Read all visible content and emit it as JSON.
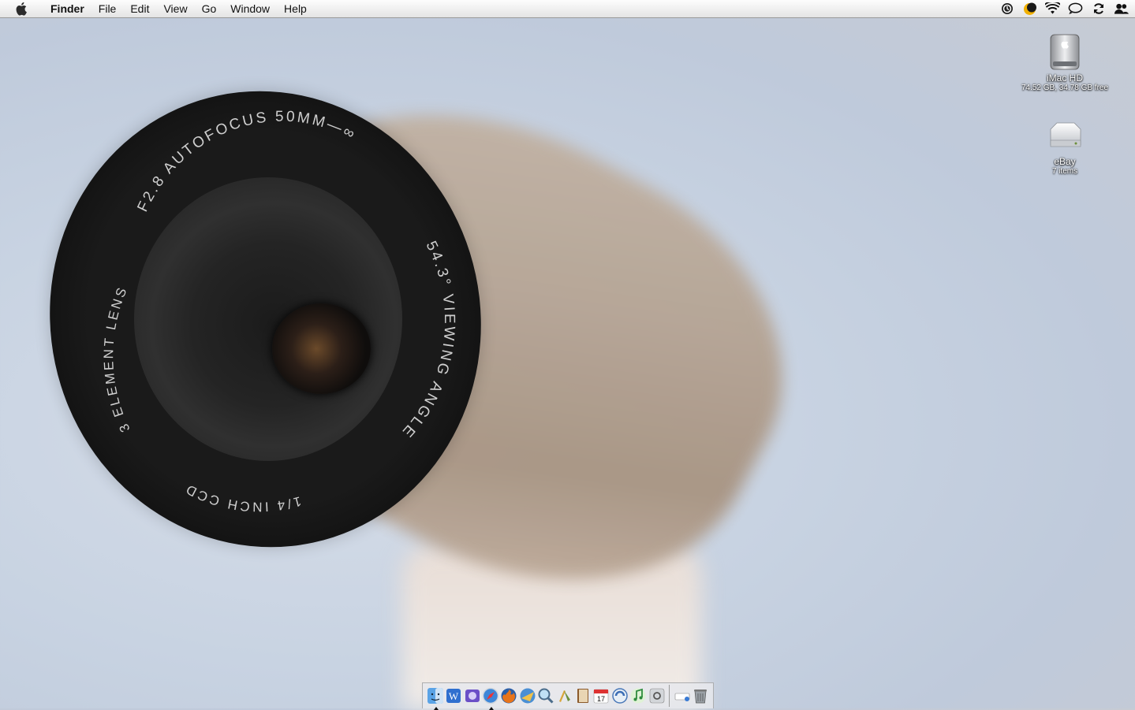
{
  "menubar": {
    "apple_icon": "apple-logo-icon",
    "app_name": "Finder",
    "menus": [
      "File",
      "Edit",
      "View",
      "Go",
      "Window",
      "Help"
    ],
    "status_icons": [
      "time-machine-icon",
      "battery-moon-icon",
      "wifi-icon",
      "ichat-icon",
      "sync-icon",
      "user-icon"
    ]
  },
  "wallpaper": {
    "lens_text_top": "F2.8 AUTOFOCUS 50MM—∞",
    "lens_text_right": "54.3° VIEWING ANGLE",
    "lens_text_left": "3 ELEMENT LENS",
    "lens_text_bottom": "1/4 INCH CCD"
  },
  "desktop": {
    "icons": [
      {
        "name": "iMac HD",
        "info": "74.52 GB, 34.78 GB free",
        "icon": "hard-drive-icon"
      },
      {
        "name": "eBay",
        "info": "7 items",
        "icon": "disk-image-icon"
      }
    ]
  },
  "dock": {
    "apps": [
      "finder-icon",
      "word-icon",
      "entourage-icon",
      "safari-icon",
      "firefox-icon",
      "mail-icon",
      "preview-icon",
      "script-icon",
      "address-book-icon",
      "ical-icon",
      "itunes-icon",
      "itunes-music-icon",
      "system-preferences-icon"
    ],
    "calendar_day": "17",
    "trash_items": [
      "documents-stack-icon",
      "trash-icon"
    ]
  }
}
